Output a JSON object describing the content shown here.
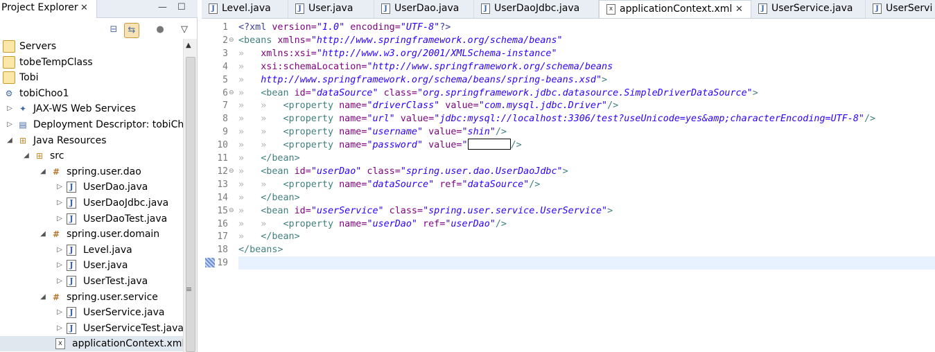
{
  "explorer": {
    "title": "Project Explorer",
    "close_glyph": "✕",
    "minimize_glyph": "—",
    "maximize_glyph": "☐",
    "menu_glyph": "▽",
    "tree": [
      {
        "label": "Servers",
        "twisty": "",
        "icon": "folder"
      },
      {
        "label": "tobeTempClass",
        "twisty": "",
        "icon": "folder"
      },
      {
        "label": "Tobi",
        "twisty": "",
        "icon": "folder"
      },
      {
        "label": "tobiChoo1",
        "twisty": "",
        "icon": "project"
      },
      {
        "label": "JAX-WS Web Services",
        "twisty": "▷",
        "icon": "webservice"
      },
      {
        "label": "Deployment Descriptor: tobiCh",
        "twisty": "▷",
        "icon": "descriptor"
      },
      {
        "label": "Java Resources",
        "twisty": "◢",
        "icon": "java-resources"
      },
      {
        "label": "src",
        "twisty": "◢",
        "icon": "source-folder"
      },
      {
        "label": "spring.user.dao",
        "twisty": "◢",
        "icon": "package"
      },
      {
        "label": "UserDao.java",
        "twisty": "▷",
        "icon": "java-file"
      },
      {
        "label": "UserDaoJdbc.java",
        "twisty": "▷",
        "icon": "java-file"
      },
      {
        "label": "UserDaoTest.java",
        "twisty": "▷",
        "icon": "java-file"
      },
      {
        "label": "spring.user.domain",
        "twisty": "◢",
        "icon": "package"
      },
      {
        "label": "Level.java",
        "twisty": "▷",
        "icon": "java-file"
      },
      {
        "label": "User.java",
        "twisty": "▷",
        "icon": "java-file"
      },
      {
        "label": "UserTest.java",
        "twisty": "▷",
        "icon": "java-file"
      },
      {
        "label": "spring.user.service",
        "twisty": "◢",
        "icon": "package"
      },
      {
        "label": "UserService.java",
        "twisty": "▷",
        "icon": "java-file"
      },
      {
        "label": "UserServiceTest.java",
        "twisty": "▷",
        "icon": "java-file"
      },
      {
        "label": "applicationContext.xml",
        "twisty": "",
        "icon": "xml-file"
      }
    ]
  },
  "editor": {
    "tabs": [
      {
        "label": "Level.java",
        "icon": "J"
      },
      {
        "label": "User.java",
        "icon": "J"
      },
      {
        "label": "UserDao.java",
        "icon": "J"
      },
      {
        "label": "UserDaoJdbc.java",
        "icon": "J"
      },
      {
        "label": "applicationContext.xml",
        "icon": "X",
        "active": true
      },
      {
        "label": "UserService.java",
        "icon": "J"
      },
      {
        "label": "UserServi",
        "icon": "J"
      }
    ],
    "tab_close_glyph": "✕",
    "code_lines": [
      {
        "n": "1",
        "fold": ""
      },
      {
        "n": "2",
        "fold": "⊖"
      },
      {
        "n": "3",
        "fold": ""
      },
      {
        "n": "4",
        "fold": ""
      },
      {
        "n": "5",
        "fold": ""
      },
      {
        "n": "6",
        "fold": "⊖"
      },
      {
        "n": "7",
        "fold": ""
      },
      {
        "n": "8",
        "fold": ""
      },
      {
        "n": "9",
        "fold": ""
      },
      {
        "n": "10",
        "fold": ""
      },
      {
        "n": "11",
        "fold": ""
      },
      {
        "n": "12",
        "fold": "⊖"
      },
      {
        "n": "13",
        "fold": ""
      },
      {
        "n": "14",
        "fold": ""
      },
      {
        "n": "15",
        "fold": "⊖"
      },
      {
        "n": "16",
        "fold": ""
      },
      {
        "n": "17",
        "fold": ""
      },
      {
        "n": "18",
        "fold": ""
      },
      {
        "n": "19",
        "fold": ""
      }
    ],
    "code": {
      "l1": [
        "<?xml",
        " version=",
        "\"1.0\"",
        " encoding=",
        "\"UTF-8\"",
        "?>"
      ],
      "l2": [
        "<beans",
        " xmlns=",
        "\"http://www.springframework.org/schema/beans\""
      ],
      "l3": [
        "xmlns:xsi=",
        "\"http://www.w3.org/2001/XMLSchema-instance\""
      ],
      "l4": [
        "xsi:schemaLocation=",
        "\"http://www.springframework.org/schema/beans"
      ],
      "l5": [
        "http://www.springframework.org/schema/beans/spring-beans.xsd\"",
        ">"
      ],
      "l6": [
        "<bean",
        " id=",
        "\"dataSource\"",
        " class=",
        "\"org.springframework.jdbc.datasource.SimpleDriverDataSource\"",
        ">"
      ],
      "l7": [
        "<property",
        " name=",
        "\"driverClass\"",
        " value=",
        "\"com.mysql.jdbc.Driver\"",
        "/>"
      ],
      "l8": [
        "<property",
        " name=",
        "\"url\"",
        " value=",
        "\"jdbc:mysql://localhost:3306/test?useUnicode=yes&amp;characterEncoding=UTF-8\"",
        "/>"
      ],
      "l9": [
        "<property",
        " name=",
        "\"username\"",
        " value=",
        "\"shin\"",
        "/>"
      ],
      "l10": [
        "<property",
        " name=",
        "\"password\"",
        " value=",
        "\"",
        "/>"
      ],
      "l11": [
        "</bean>"
      ],
      "l12": [
        "<bean",
        " id=",
        "\"userDao\"",
        " class=",
        "\"spring.user.dao.UserDaoJdbc\"",
        ">"
      ],
      "l13": [
        "<property",
        " name=",
        "\"dataSource\"",
        " ref=",
        "\"dataSource\"",
        "/>"
      ],
      "l14": [
        "</bean>"
      ],
      "l15": [
        "<bean",
        " id=",
        "\"userService\"",
        " class=",
        "\"spring.user.service.UserService\"",
        ">"
      ],
      "l16": [
        "<property",
        " name=",
        "\"userDao\"",
        " ref=",
        "\"userDao\"",
        "/>"
      ],
      "l17": [
        "</bean>"
      ],
      "l18": [
        "</beans>"
      ]
    },
    "indent_marker": "»",
    "space_marker": "·"
  }
}
